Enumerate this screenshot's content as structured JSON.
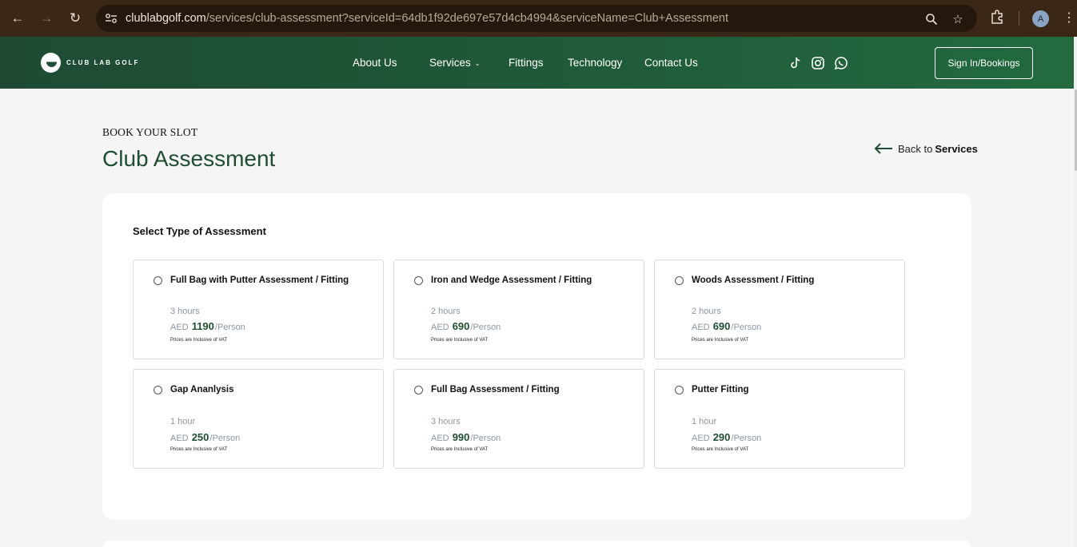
{
  "browser": {
    "url_host": "clublabgolf.com",
    "url_path": "/services/club-assessment?serviceId=64db1f92de697e57d4cb4994&serviceName=Club+Assessment",
    "avatar_letter": "A"
  },
  "header": {
    "logo_text": "CLUB LAB GOLF",
    "nav": {
      "about": "About Us",
      "services": "Services",
      "fittings": "Fittings",
      "technology": "Technology",
      "contact": "Contact Us"
    },
    "signin_label": "Sign In/Bookings",
    "brand_color": "#1f4d34"
  },
  "page": {
    "eyebrow": "BOOK YOUR SLOT",
    "title": "Club Assessment",
    "back_prefix": "Back to",
    "back_target": "Services",
    "section_label": "Select Type of Assessment"
  },
  "options": [
    {
      "name": "Full Bag with Putter Assessment / Fitting",
      "duration": "3 hours",
      "currency": "AED",
      "price": "1190",
      "unit": "/Person",
      "vat": "Prices are Inclusive of VAT"
    },
    {
      "name": "Iron and Wedge Assessment / Fitting",
      "duration": "2 hours",
      "currency": "AED",
      "price": "690",
      "unit": "/Person",
      "vat": "Prices are Inclusive of VAT"
    },
    {
      "name": "Woods Assessment / Fitting",
      "duration": "2 hours",
      "currency": "AED",
      "price": "690",
      "unit": "/Person",
      "vat": "Prices are Inclusive of VAT"
    },
    {
      "name": "Gap Ananlysis",
      "duration": "1 hour",
      "currency": "AED",
      "price": "250",
      "unit": "/Person",
      "vat": "Prices are Inclusive of VAT"
    },
    {
      "name": "Full Bag Assessment / Fitting",
      "duration": "3 hours",
      "currency": "AED",
      "price": "990",
      "unit": "/Person",
      "vat": "Prices are Inclusive of VAT"
    },
    {
      "name": "Putter Fitting",
      "duration": "1 hour",
      "currency": "AED",
      "price": "290",
      "unit": "/Person",
      "vat": "Prices are Inclusive of VAT"
    }
  ]
}
